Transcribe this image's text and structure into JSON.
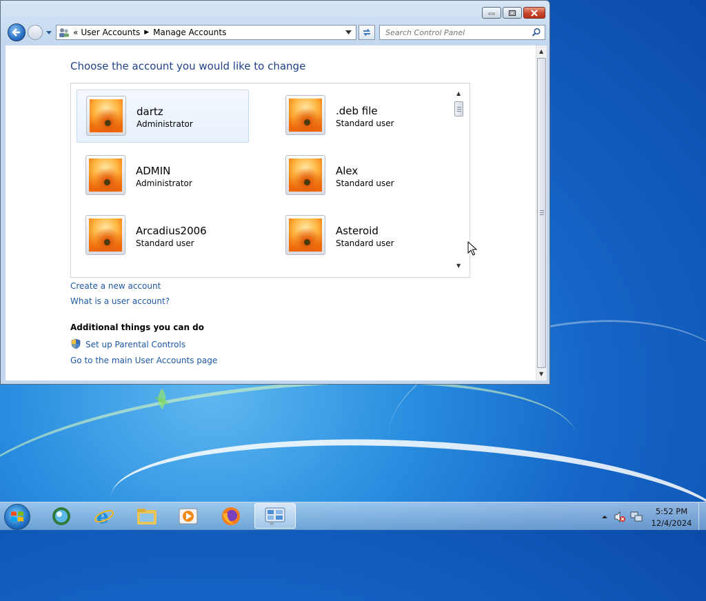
{
  "window": {
    "address": {
      "overflow": "«",
      "crumbs": [
        "User Accounts",
        "Manage Accounts"
      ]
    },
    "search_placeholder": "Search Control Panel"
  },
  "content": {
    "title": "Choose the account you would like to change",
    "accounts": [
      {
        "name": "dartz",
        "role": "Administrator",
        "selected": true
      },
      {
        "name": ".deb file",
        "role": "Standard user"
      },
      {
        "name": "ADMIN",
        "role": "Administrator"
      },
      {
        "name": "Alex",
        "role": "Standard user"
      },
      {
        "name": "Arcadius2006",
        "role": "Standard user"
      },
      {
        "name": "Asteroid",
        "role": "Standard user"
      }
    ],
    "links": {
      "create": "Create a new account",
      "what_is": "What is a user account?"
    },
    "additional": {
      "heading": "Additional things you can do",
      "parental": "Set up Parental Controls",
      "main_page": "Go to the main User Accounts page"
    }
  },
  "taskbar": {
    "icons": [
      "start-orb",
      "media-center-icon",
      "internet-explorer-icon",
      "windows-explorer-icon",
      "media-player-icon",
      "firefox-icon",
      "control-panel-icon"
    ],
    "clock_time": "5:52 PM",
    "clock_date": "12/4/2024"
  }
}
